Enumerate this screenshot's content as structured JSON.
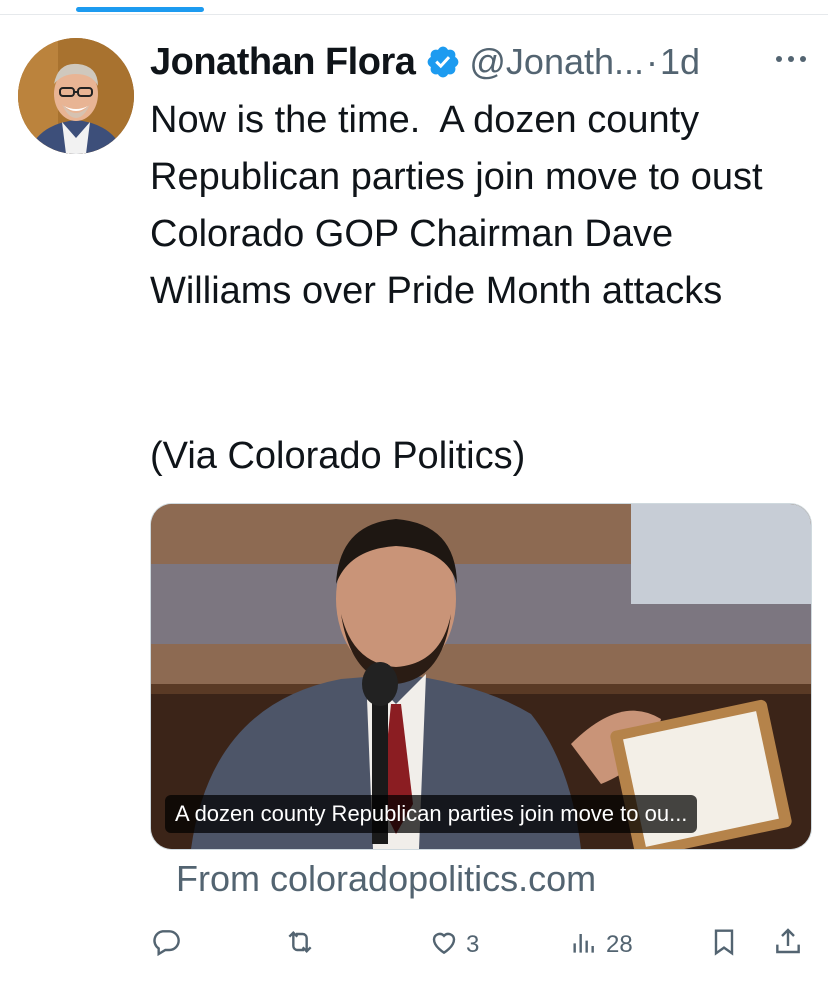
{
  "tweet": {
    "author_name": "Jonathan Flora",
    "handle": "@Jonath...",
    "separator": "·",
    "time": "1d",
    "text": "Now is the time.  A dozen county Republican parties join move to oust Colorado GOP Chairman Dave Williams over Pride Month attacks",
    "via": "(Via Colorado Politics)"
  },
  "card": {
    "caption": "A dozen county Republican parties join move to ou...",
    "source": "From coloradopolitics.com"
  },
  "actions": {
    "reply_count": "",
    "retweet_count": "",
    "like_count": "3",
    "views_count": "28"
  },
  "colors": {
    "accent": "#1d9bf0",
    "muted": "#536471",
    "text": "#0f1419"
  },
  "icons": [
    "verified-badge-icon",
    "more-icon",
    "reply-icon",
    "retweet-icon",
    "like-icon",
    "views-icon",
    "bookmark-icon",
    "share-icon"
  ]
}
